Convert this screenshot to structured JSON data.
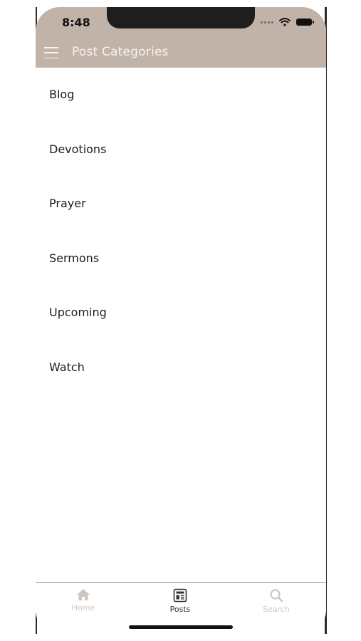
{
  "status_bar": {
    "time": "8:48",
    "icons": [
      "signal-dots-icon",
      "wifi-icon",
      "battery-icon"
    ]
  },
  "header": {
    "title": "Post Categories",
    "menu_icon": "hamburger-menu-icon",
    "background_color": "#c2b3a9"
  },
  "categories": [
    {
      "label": "Blog"
    },
    {
      "label": "Devotions"
    },
    {
      "label": "Prayer"
    },
    {
      "label": "Sermons"
    },
    {
      "label": "Upcoming"
    },
    {
      "label": "Watch"
    }
  ],
  "tab_bar": {
    "tabs": [
      {
        "label": "Home",
        "icon": "home-icon",
        "active": false
      },
      {
        "label": "Posts",
        "icon": "posts-icon",
        "active": true
      },
      {
        "label": "Search",
        "icon": "search-icon",
        "active": false
      }
    ]
  }
}
